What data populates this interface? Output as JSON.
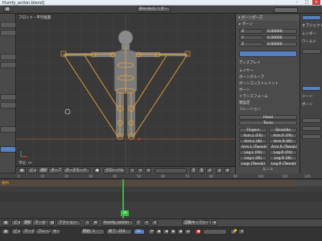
{
  "window": {
    "title": "Humfy_action.blend]"
  },
  "viewport": {
    "label": "フロント・平行投影",
    "units_label": "単位: m"
  },
  "viewport_header": {
    "view_menu": "ビュー",
    "select_menu": "選択",
    "pose_menu": "ポーズ",
    "mode": "ポーズモード",
    "pivot": "グローバル"
  },
  "topbar": {
    "render_engine": "Blenderレンダー"
  },
  "properties": {
    "section_armature": "ボーンポーズ",
    "sub": "ボーン",
    "values": [
      "0.00000",
      "0.00000",
      "0.00000"
    ],
    "section_items": [
      "ディスプレイ",
      "レイヤー",
      "ボーングループ",
      "ボーンコンストレイント",
      "ボーン",
      "トランスフォーム",
      "親設定",
      "リレーション",
      "表示",
      "デフォルメ",
      "カスタムプロパティ"
    ],
    "lr_pairs": [
      [
        "Fingers",
        "Straddle"
      ],
      [
        "Arm.L (FK)",
        "Arm.R (FK)"
      ],
      [
        "Arm.L (IK)",
        "Arm.R (IK)"
      ],
      [
        "Arm.L (Tweak)",
        "Arm.R (Tweak)"
      ],
      [
        "Leg.L (FK)",
        "Leg.R (FK)"
      ],
      [
        "Leg.L (IK)",
        "Leg.R (IK)"
      ],
      [
        "Legs (Tweak)",
        "Leg.R (Tweak)"
      ]
    ],
    "lr_top": [
      "Head",
      "Torso"
    ],
    "footer_label": "ルート"
  },
  "right_panel": {
    "items": [
      "オブジェクト",
      "レンダー",
      "ワールド",
      "シーン",
      "ボーン"
    ]
  },
  "timeline": {
    "header_label": "要約",
    "current_frame": "36",
    "ticks": [
      "0",
      "10",
      "20",
      "30",
      "40",
      "50",
      "60",
      "70",
      "80",
      "90",
      "100",
      "110",
      "120"
    ]
  },
  "timeline_footer": {
    "view": "ビュー",
    "select": "選択",
    "marker": "マーカー",
    "frame": "フレーム",
    "key": "キー",
    "action_label": "アクション",
    "action_name": "Humfy_action",
    "start": "開始: 1",
    "end": "終了: 250",
    "interp": "自動キーフレーム"
  },
  "colors": {
    "bone_orange": "#e8a23a",
    "accent_blue": "#5680c2",
    "frame_green": "#2fbf3a",
    "timeline_bg": "#3d3d3d"
  }
}
